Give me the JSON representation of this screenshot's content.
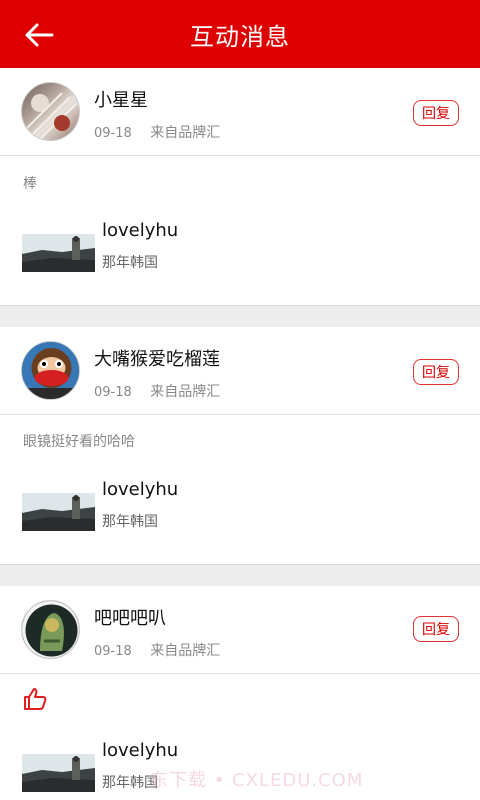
{
  "header": {
    "title": "互动消息",
    "back_icon": "arrow-left-icon"
  },
  "messages": [
    {
      "username": "小星星",
      "date": "09-18",
      "source": "来自品牌汇",
      "reply_label": "回复",
      "comment": "棒",
      "ref": {
        "title": "lovelyhu",
        "subtitle": "那年韩国"
      }
    },
    {
      "username": "大嘴猴爱吃榴莲",
      "date": "09-18",
      "source": "来自品牌汇",
      "reply_label": "回复",
      "comment": "眼镜挺好看的哈哈",
      "ref": {
        "title": "lovelyhu",
        "subtitle": "那年韩国"
      }
    },
    {
      "username": "吧吧吧叭",
      "date": "09-18",
      "source": "来自品牌汇",
      "reply_label": "回复",
      "comment_icon": "thumbs-up-icon",
      "ref": {
        "title": "lovelyhu",
        "subtitle": "那年韩国"
      }
    }
  ],
  "watermark": "东下载 • CXLEDU.COM",
  "colors": {
    "brand_red": "#de0000",
    "separator": "#ededed"
  }
}
